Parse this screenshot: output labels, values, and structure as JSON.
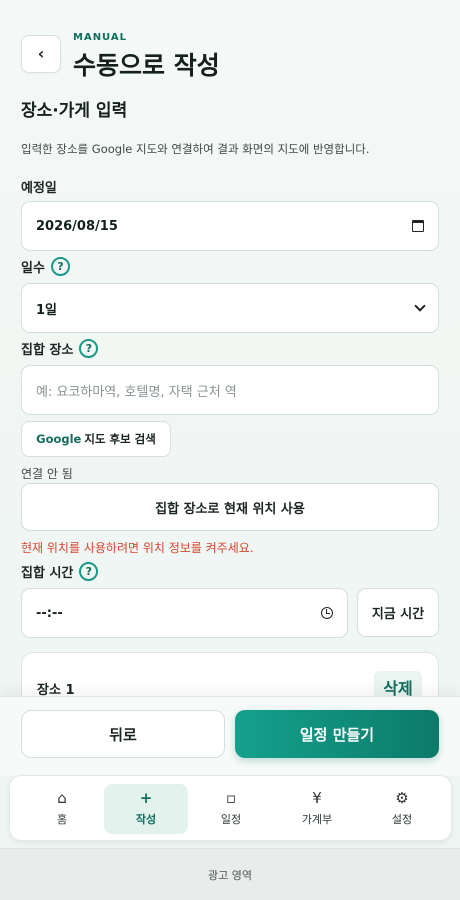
{
  "header": {
    "back_glyph": "‹",
    "eyebrow": "MANUAL",
    "title": "수동으로 작성"
  },
  "section": {
    "title": "장소·가게 입력",
    "description": "입력한 장소를 Google 지도와 연결하여 결과 화면의 지도에 반영합니다."
  },
  "date": {
    "label": "예정일",
    "value": "2026/08/15"
  },
  "days": {
    "label": "일수",
    "help": "?",
    "selected": "1일"
  },
  "meeting_place": {
    "label": "집합 장소",
    "help": "?",
    "placeholder": "예: 요코하마역, 호텔명, 자택 근처 역",
    "google_prefix": "Google",
    "google_suffix": "지도 후보 검색",
    "status": "연결 안 됨",
    "use_current_location": "집합 장소로 현재 위치 사용",
    "error": "현재 위치를 사용하려면 위치 정보를 켜주세요."
  },
  "meeting_time": {
    "label": "집합 시간",
    "help": "?",
    "value": "--:--",
    "now_button": "지금 시간"
  },
  "place_card": {
    "title": "장소 1",
    "delete_label": "삭제"
  },
  "actions": {
    "back": "뒤로",
    "create": "일정 만들기"
  },
  "nav": {
    "items": [
      {
        "icon": "⌂",
        "label": "홈"
      },
      {
        "icon": "+",
        "label": "작성"
      },
      {
        "icon": "▫",
        "label": "일정"
      },
      {
        "icon": "¥",
        "label": "가계부"
      },
      {
        "icon": "⚙",
        "label": "설정"
      }
    ],
    "active_index": 1
  },
  "ad": {
    "label": "광고 영역"
  },
  "colors": {
    "accent": "#0f6e5c",
    "accent_gradient_start": "#14a18e",
    "error": "#d6452f"
  }
}
